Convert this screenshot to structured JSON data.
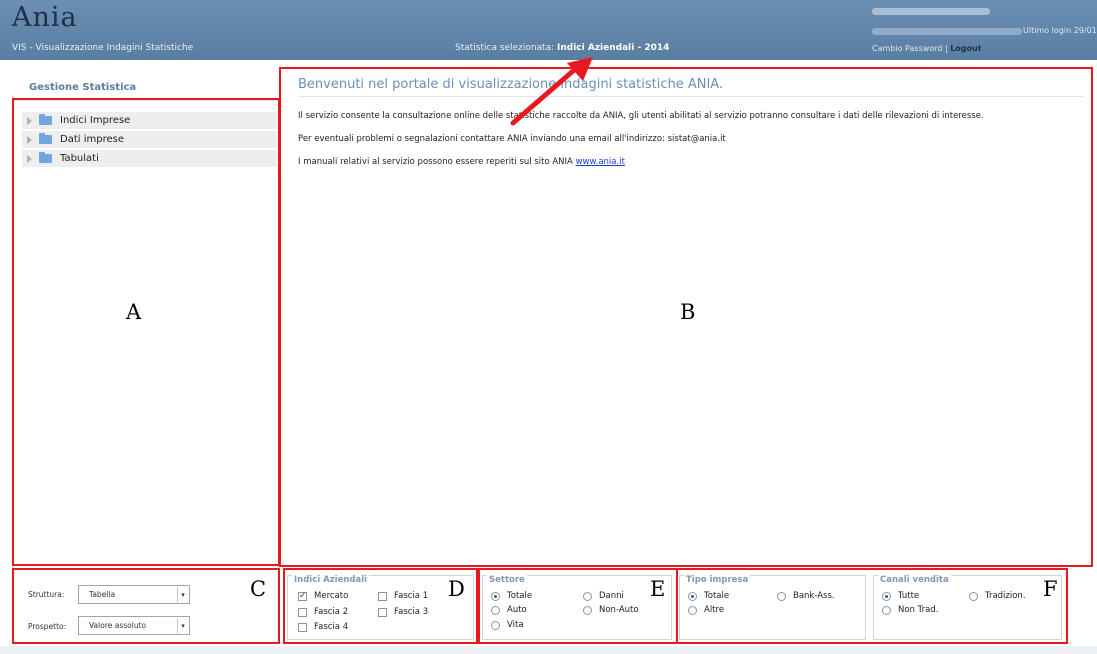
{
  "header": {
    "logo": "Ania",
    "subtitle": "VIS - Visualizzazione Indagini Statistiche",
    "stat_prefix": "Statistica selezionata:",
    "stat_value": "Indici Aziendali - 2014",
    "last_login": "Ultimo login 29/01",
    "change_password": "Cambio Password",
    "separator": "|",
    "logout": "Logout"
  },
  "sidebar": {
    "title": "Gestione Statistica",
    "items": [
      {
        "label": "Indici Imprese"
      },
      {
        "label": "Dati imprese"
      },
      {
        "label": "Tabulati"
      }
    ]
  },
  "main": {
    "welcome": "Benvenuti nel portale di visualizzazione indagini statistiche ANIA.",
    "para1": "Il servizio consente la consultazione online delle statistiche raccolte da ANIA, gli utenti abilitati al servizio potranno consultare i dati delle rilevazioni di interesse.",
    "para2": "Per eventuali problemi o segnalazioni contattare ANIA inviando una email all'indirizzo: sistat@ania.it",
    "para3_prefix": "I manuali relativi al servizio possono essere reperiti sul sito ANIA",
    "para3_link": "www.ania.it"
  },
  "controls": {
    "struttura_label": "Struttura:",
    "struttura_value": "Tabella",
    "prospetto_label": "Prospetto:",
    "prospetto_value": "Valore assoluto"
  },
  "indici": {
    "title": "Indici Aziendali",
    "options": [
      {
        "label": "Mercato",
        "checked": true
      },
      {
        "label": "Fascia 1",
        "checked": false
      },
      {
        "label": "Fascia 2",
        "checked": false
      },
      {
        "label": "Fascia 3",
        "checked": false
      },
      {
        "label": "Fascia 4",
        "checked": false
      }
    ]
  },
  "settore": {
    "title": "Settore",
    "options": [
      {
        "label": "Totale",
        "selected": true
      },
      {
        "label": "Danni",
        "selected": false
      },
      {
        "label": "Auto",
        "selected": false
      },
      {
        "label": "Non-Auto",
        "selected": false
      },
      {
        "label": "Vita",
        "selected": false
      }
    ]
  },
  "tipo": {
    "title": "Tipo impresa",
    "options": [
      {
        "label": "Totale",
        "selected": true
      },
      {
        "label": "Bank-Ass.",
        "selected": false
      },
      {
        "label": "Altre",
        "selected": false
      }
    ]
  },
  "canali": {
    "title": "Canali vendita",
    "options": [
      {
        "label": "Tutte",
        "selected": true
      },
      {
        "label": "Tradizion.",
        "selected": false
      },
      {
        "label": "Non Trad.",
        "selected": false
      }
    ]
  },
  "annotations": {
    "a": "A",
    "b": "B",
    "c": "C",
    "d": "D",
    "e": "E",
    "f": "F",
    "box_color": "#e8191e"
  }
}
